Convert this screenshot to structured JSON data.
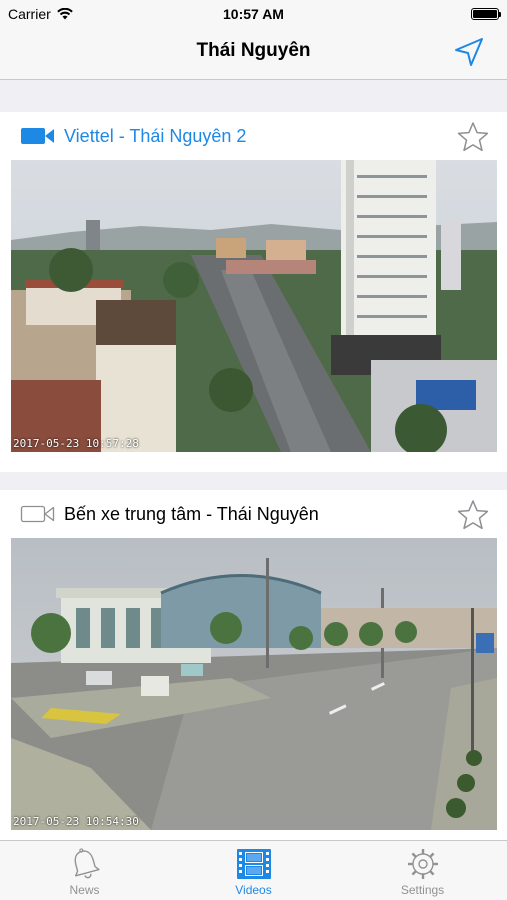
{
  "status_bar": {
    "carrier": "Carrier",
    "time": "10:57 AM"
  },
  "nav": {
    "title": "Thái Nguyên",
    "location_icon": "location-arrow-icon"
  },
  "colors": {
    "accent": "#1e88e5",
    "inactive": "#929292"
  },
  "cameras": [
    {
      "title": "Viettel - Thái Nguyên 2",
      "timestamp": "2017-05-23 10:57:28",
      "active": true,
      "favorite": false
    },
    {
      "title": "Bến xe trung tâm - Thái Nguyên",
      "timestamp": "2017-05-23 10:54:30",
      "active": false,
      "favorite": false
    }
  ],
  "tabs": [
    {
      "label": "News",
      "icon": "bell-icon",
      "selected": false
    },
    {
      "label": "Videos",
      "icon": "film-icon",
      "selected": true
    },
    {
      "label": "Settings",
      "icon": "gear-icon",
      "selected": false
    }
  ]
}
